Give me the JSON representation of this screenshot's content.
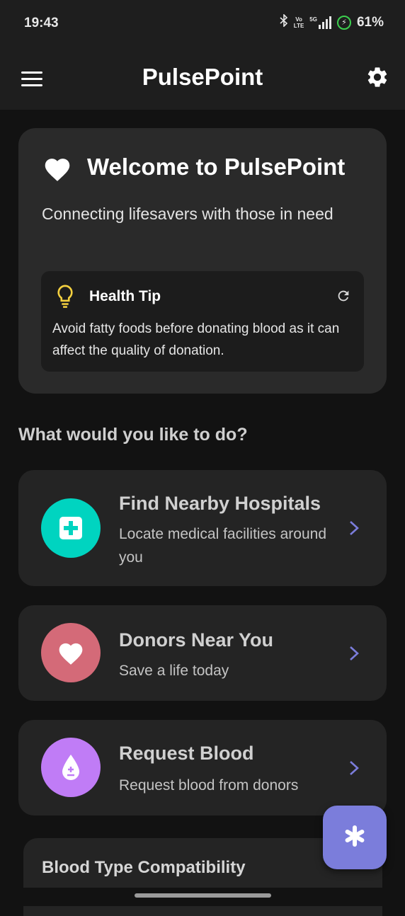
{
  "status_bar": {
    "time": "19:43",
    "network_label": "Vo\nLTE",
    "network_gen": "5G",
    "battery_percent": "61%"
  },
  "app_bar": {
    "title": "PulsePoint",
    "menu_icon": "hamburger-menu-icon",
    "settings_icon": "gear-icon"
  },
  "welcome": {
    "title": "Welcome to PulsePoint",
    "subtitle": "Connecting lifesavers with those in need",
    "icon": "heart-icon",
    "tip": {
      "title": "Health Tip",
      "text": "Avoid fatty foods before donating blood as it can affect the quality of donation.",
      "icon": "lightbulb-icon",
      "refresh_icon": "refresh-icon"
    }
  },
  "section_heading": "What would you like to do?",
  "actions": [
    {
      "title": "Find Nearby Hospitals",
      "subtitle": "Locate medical facilities around you",
      "icon": "hospital-cross-icon",
      "color": "#00d4c0"
    },
    {
      "title": "Donors Near You",
      "subtitle": "Save a life today",
      "icon": "heart-icon",
      "color": "#d46a78"
    },
    {
      "title": "Request Blood",
      "subtitle": "Request blood from donors",
      "icon": "blood-drop-icon",
      "color": "#c07cf6"
    }
  ],
  "compatibility": {
    "title": "Blood Type Compatibility"
  },
  "fab": {
    "icon": "asterisk-icon",
    "color": "#7b7ddb"
  },
  "colors": {
    "background": "#121212",
    "card": "#2a2a2a",
    "chevron": "#7b7ddb",
    "tip_bulb": "#f4d03f"
  }
}
